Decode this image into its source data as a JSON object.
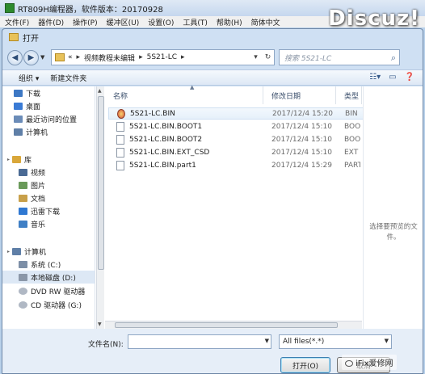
{
  "app": {
    "title": "RT809H编程器，软件版本：20170928",
    "menu": [
      "文件(F)",
      "器件(D)",
      "操作(P)",
      "缓冲区(U)",
      "设置(O)",
      "工具(T)",
      "帮助(H)",
      "简体中文"
    ],
    "watermark": "Discuz!"
  },
  "dialog": {
    "title": "打开",
    "breadcrumb": {
      "prefix": "«",
      "parts": [
        "视频教程未编辑",
        "5S21-LC"
      ]
    },
    "search_placeholder": "搜索 5S21-LC",
    "toolbar": {
      "organize": "组织 ▾",
      "new_folder": "新建文件夹"
    },
    "nav": {
      "items": [
        {
          "label": "下载",
          "icon": "download-icon",
          "color": "#3d78c4"
        },
        {
          "label": "桌面",
          "icon": "desktop-icon",
          "color": "#3a7bd5"
        },
        {
          "label": "最近访问的位置",
          "icon": "recent-places-icon",
          "color": "#6b8cb8"
        },
        {
          "label": "计算机",
          "icon": "computer-icon",
          "color": "#5f7fa7"
        },
        {
          "label": "库",
          "icon": "library-icon",
          "color": "#d9a73a"
        },
        {
          "label": "视频",
          "icon": "video-icon",
          "color": "#4a6a94"
        },
        {
          "label": "图片",
          "icon": "pictures-icon",
          "color": "#6a9a5a"
        },
        {
          "label": "文档",
          "icon": "documents-icon",
          "color": "#c8a04a"
        },
        {
          "label": "迅雷下载",
          "icon": "xunlei-icon",
          "color": "#2f78d2"
        },
        {
          "label": "音乐",
          "icon": "music-icon",
          "color": "#3f7fc5"
        },
        {
          "label": "计算机",
          "icon": "computer-icon",
          "color": "#5f7fa7"
        },
        {
          "label": "系统 (C:)",
          "icon": "drive-icon",
          "color": "#7d8fa7"
        },
        {
          "label": "本地磁盘 (D:)",
          "icon": "drive-icon",
          "color": "#8b97a8"
        },
        {
          "label": "DVD RW 驱动器",
          "icon": "dvd-icon",
          "color": "#b0b8c4"
        },
        {
          "label": "CD 驱动器 (G:)",
          "icon": "cd-icon",
          "color": "#b0b8c4"
        }
      ]
    },
    "columns": {
      "name": "名称",
      "date": "修改日期",
      "type": "类型"
    },
    "files": [
      {
        "name": "5S21-LC.BIN",
        "date": "2017/12/4 15:20",
        "type": "BIN"
      },
      {
        "name": "5S21-LC.BIN.BOOT1",
        "date": "2017/12/4 15:10",
        "type": "BOOT"
      },
      {
        "name": "5S21-LC.BIN.BOOT2",
        "date": "2017/12/4 15:10",
        "type": "BOOT"
      },
      {
        "name": "5S21-LC.BIN.EXT_CSD",
        "date": "2017/12/4 15:10",
        "type": "EXT"
      },
      {
        "name": "5S21-LC.BIN.part1",
        "date": "2017/12/4 15:29",
        "type": "PART"
      }
    ],
    "preview_text": "选择要预览的文件。",
    "footer": {
      "filename_label": "文件名(N):",
      "filename_value": "",
      "filter_value": "All files(*.*)",
      "open_label": "打开(O)",
      "cancel_label": "取消",
      "wechat_label": "iFix爱修网"
    }
  }
}
